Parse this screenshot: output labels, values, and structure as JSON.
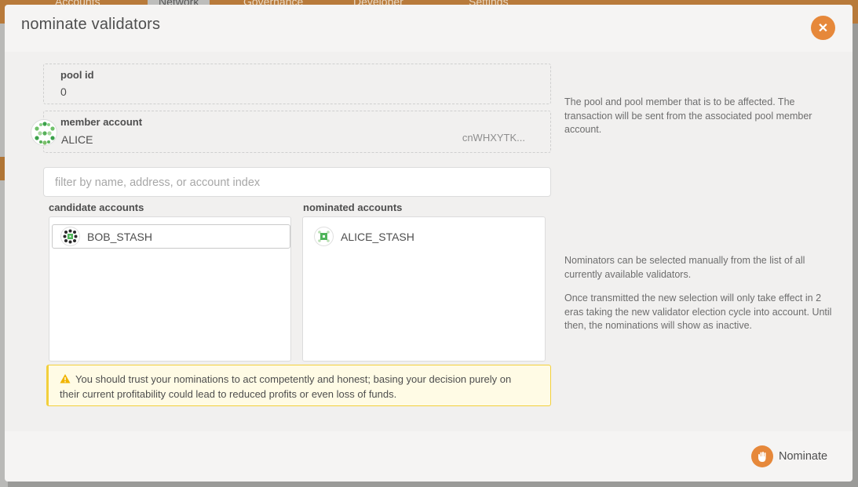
{
  "background": {
    "nav": [
      {
        "label": "Accounts"
      },
      {
        "label": "Network"
      },
      {
        "label": "Governance"
      },
      {
        "label": "Developer"
      },
      {
        "label": "Settings"
      }
    ]
  },
  "modal": {
    "title": "nominate validators",
    "close_icon": "close-icon",
    "pool_id": {
      "label": "pool id",
      "value": "0"
    },
    "member_account": {
      "label": "member account",
      "name": "ALICE",
      "address": "cnWHXYTK..."
    },
    "help_pool": "The pool and pool member that is to be affected. The transaction will be sent from the associated pool member account.",
    "filter_placeholder": "filter by name, address, or account index",
    "candidate": {
      "label": "candidate accounts",
      "items": [
        {
          "name": "BOB_STASH"
        }
      ]
    },
    "nominated": {
      "label": "nominated accounts",
      "items": [
        {
          "name": "ALICE_STASH"
        }
      ]
    },
    "help_nominators": "Nominators can be selected manually from the list of all currently available validators.",
    "help_eras": "Once transmitted the new selection will only take effect in 2 eras taking the new validator election cycle into account. Until then, the nominations will show as inactive.",
    "warning": "You should trust your nominations to act competently and honest; basing your decision purely on their current profitability could lead to reduced profits or even loss of funds.",
    "nominate_button": "Nominate",
    "accent_color": "#e6883a",
    "warning_color": "#f2cf3c"
  }
}
